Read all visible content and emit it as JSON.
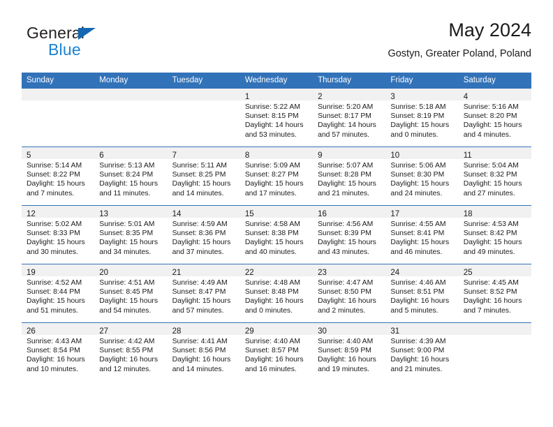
{
  "brand": {
    "name_part1": "General",
    "name_part2": "Blue",
    "triangle_color": "#1567b3",
    "blue_color": "#1c83d4"
  },
  "header": {
    "title": "May 2024",
    "subtitle": "Gostyn, Greater Poland, Poland"
  },
  "theme": {
    "header_row_bg": "#3272b8",
    "daynum_band_bg": "#f1f1f1",
    "grid_line": "#3272b8"
  },
  "weekdays": [
    "Sunday",
    "Monday",
    "Tuesday",
    "Wednesday",
    "Thursday",
    "Friday",
    "Saturday"
  ],
  "weeks": [
    [
      {
        "day": "",
        "sunrise": "",
        "sunset": "",
        "daylight1": "",
        "daylight2": ""
      },
      {
        "day": "",
        "sunrise": "",
        "sunset": "",
        "daylight1": "",
        "daylight2": ""
      },
      {
        "day": "",
        "sunrise": "",
        "sunset": "",
        "daylight1": "",
        "daylight2": ""
      },
      {
        "day": "1",
        "sunrise": "Sunrise: 5:22 AM",
        "sunset": "Sunset: 8:15 PM",
        "daylight1": "Daylight: 14 hours",
        "daylight2": "and 53 minutes."
      },
      {
        "day": "2",
        "sunrise": "Sunrise: 5:20 AM",
        "sunset": "Sunset: 8:17 PM",
        "daylight1": "Daylight: 14 hours",
        "daylight2": "and 57 minutes."
      },
      {
        "day": "3",
        "sunrise": "Sunrise: 5:18 AM",
        "sunset": "Sunset: 8:19 PM",
        "daylight1": "Daylight: 15 hours",
        "daylight2": "and 0 minutes."
      },
      {
        "day": "4",
        "sunrise": "Sunrise: 5:16 AM",
        "sunset": "Sunset: 8:20 PM",
        "daylight1": "Daylight: 15 hours",
        "daylight2": "and 4 minutes."
      }
    ],
    [
      {
        "day": "5",
        "sunrise": "Sunrise: 5:14 AM",
        "sunset": "Sunset: 8:22 PM",
        "daylight1": "Daylight: 15 hours",
        "daylight2": "and 7 minutes."
      },
      {
        "day": "6",
        "sunrise": "Sunrise: 5:13 AM",
        "sunset": "Sunset: 8:24 PM",
        "daylight1": "Daylight: 15 hours",
        "daylight2": "and 11 minutes."
      },
      {
        "day": "7",
        "sunrise": "Sunrise: 5:11 AM",
        "sunset": "Sunset: 8:25 PM",
        "daylight1": "Daylight: 15 hours",
        "daylight2": "and 14 minutes."
      },
      {
        "day": "8",
        "sunrise": "Sunrise: 5:09 AM",
        "sunset": "Sunset: 8:27 PM",
        "daylight1": "Daylight: 15 hours",
        "daylight2": "and 17 minutes."
      },
      {
        "day": "9",
        "sunrise": "Sunrise: 5:07 AM",
        "sunset": "Sunset: 8:28 PM",
        "daylight1": "Daylight: 15 hours",
        "daylight2": "and 21 minutes."
      },
      {
        "day": "10",
        "sunrise": "Sunrise: 5:06 AM",
        "sunset": "Sunset: 8:30 PM",
        "daylight1": "Daylight: 15 hours",
        "daylight2": "and 24 minutes."
      },
      {
        "day": "11",
        "sunrise": "Sunrise: 5:04 AM",
        "sunset": "Sunset: 8:32 PM",
        "daylight1": "Daylight: 15 hours",
        "daylight2": "and 27 minutes."
      }
    ],
    [
      {
        "day": "12",
        "sunrise": "Sunrise: 5:02 AM",
        "sunset": "Sunset: 8:33 PM",
        "daylight1": "Daylight: 15 hours",
        "daylight2": "and 30 minutes."
      },
      {
        "day": "13",
        "sunrise": "Sunrise: 5:01 AM",
        "sunset": "Sunset: 8:35 PM",
        "daylight1": "Daylight: 15 hours",
        "daylight2": "and 34 minutes."
      },
      {
        "day": "14",
        "sunrise": "Sunrise: 4:59 AM",
        "sunset": "Sunset: 8:36 PM",
        "daylight1": "Daylight: 15 hours",
        "daylight2": "and 37 minutes."
      },
      {
        "day": "15",
        "sunrise": "Sunrise: 4:58 AM",
        "sunset": "Sunset: 8:38 PM",
        "daylight1": "Daylight: 15 hours",
        "daylight2": "and 40 minutes."
      },
      {
        "day": "16",
        "sunrise": "Sunrise: 4:56 AM",
        "sunset": "Sunset: 8:39 PM",
        "daylight1": "Daylight: 15 hours",
        "daylight2": "and 43 minutes."
      },
      {
        "day": "17",
        "sunrise": "Sunrise: 4:55 AM",
        "sunset": "Sunset: 8:41 PM",
        "daylight1": "Daylight: 15 hours",
        "daylight2": "and 46 minutes."
      },
      {
        "day": "18",
        "sunrise": "Sunrise: 4:53 AM",
        "sunset": "Sunset: 8:42 PM",
        "daylight1": "Daylight: 15 hours",
        "daylight2": "and 49 minutes."
      }
    ],
    [
      {
        "day": "19",
        "sunrise": "Sunrise: 4:52 AM",
        "sunset": "Sunset: 8:44 PM",
        "daylight1": "Daylight: 15 hours",
        "daylight2": "and 51 minutes."
      },
      {
        "day": "20",
        "sunrise": "Sunrise: 4:51 AM",
        "sunset": "Sunset: 8:45 PM",
        "daylight1": "Daylight: 15 hours",
        "daylight2": "and 54 minutes."
      },
      {
        "day": "21",
        "sunrise": "Sunrise: 4:49 AM",
        "sunset": "Sunset: 8:47 PM",
        "daylight1": "Daylight: 15 hours",
        "daylight2": "and 57 minutes."
      },
      {
        "day": "22",
        "sunrise": "Sunrise: 4:48 AM",
        "sunset": "Sunset: 8:48 PM",
        "daylight1": "Daylight: 16 hours",
        "daylight2": "and 0 minutes."
      },
      {
        "day": "23",
        "sunrise": "Sunrise: 4:47 AM",
        "sunset": "Sunset: 8:50 PM",
        "daylight1": "Daylight: 16 hours",
        "daylight2": "and 2 minutes."
      },
      {
        "day": "24",
        "sunrise": "Sunrise: 4:46 AM",
        "sunset": "Sunset: 8:51 PM",
        "daylight1": "Daylight: 16 hours",
        "daylight2": "and 5 minutes."
      },
      {
        "day": "25",
        "sunrise": "Sunrise: 4:45 AM",
        "sunset": "Sunset: 8:52 PM",
        "daylight1": "Daylight: 16 hours",
        "daylight2": "and 7 minutes."
      }
    ],
    [
      {
        "day": "26",
        "sunrise": "Sunrise: 4:43 AM",
        "sunset": "Sunset: 8:54 PM",
        "daylight1": "Daylight: 16 hours",
        "daylight2": "and 10 minutes."
      },
      {
        "day": "27",
        "sunrise": "Sunrise: 4:42 AM",
        "sunset": "Sunset: 8:55 PM",
        "daylight1": "Daylight: 16 hours",
        "daylight2": "and 12 minutes."
      },
      {
        "day": "28",
        "sunrise": "Sunrise: 4:41 AM",
        "sunset": "Sunset: 8:56 PM",
        "daylight1": "Daylight: 16 hours",
        "daylight2": "and 14 minutes."
      },
      {
        "day": "29",
        "sunrise": "Sunrise: 4:40 AM",
        "sunset": "Sunset: 8:57 PM",
        "daylight1": "Daylight: 16 hours",
        "daylight2": "and 16 minutes."
      },
      {
        "day": "30",
        "sunrise": "Sunrise: 4:40 AM",
        "sunset": "Sunset: 8:59 PM",
        "daylight1": "Daylight: 16 hours",
        "daylight2": "and 19 minutes."
      },
      {
        "day": "31",
        "sunrise": "Sunrise: 4:39 AM",
        "sunset": "Sunset: 9:00 PM",
        "daylight1": "Daylight: 16 hours",
        "daylight2": "and 21 minutes."
      },
      {
        "day": "",
        "sunrise": "",
        "sunset": "",
        "daylight1": "",
        "daylight2": ""
      }
    ]
  ]
}
